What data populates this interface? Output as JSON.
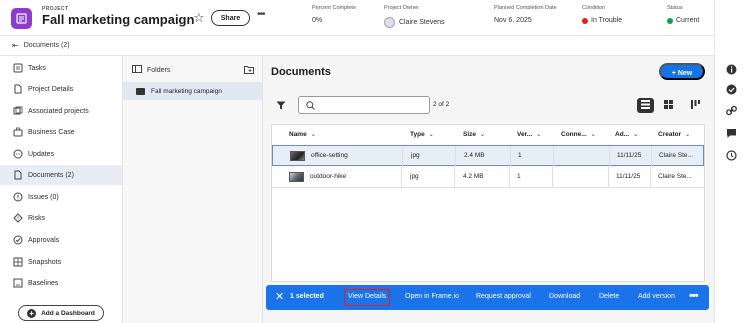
{
  "header": {
    "project_label": "PROJECT",
    "title": "Fall marketing campaign",
    "share_label": "Share",
    "meta": {
      "percent_label": "Percent Complete",
      "percent_value": "0%",
      "owner_label": "Project Owner",
      "owner_value": "Claire Stevens",
      "planned_label": "Planned Completion Date",
      "planned_value": "Nov 6, 2025",
      "condition_label": "Condition",
      "condition_value": "In Trouble",
      "condition_color": "#e02020",
      "status_label": "Status",
      "status_value": "Current",
      "status_color": "#12a14b"
    }
  },
  "breadcrumb": {
    "label": "Documents (2)"
  },
  "sidebar": {
    "items": [
      {
        "label": "Tasks",
        "icon": "tasks-icon"
      },
      {
        "label": "Project Details",
        "icon": "details-icon"
      },
      {
        "label": "Associated projects",
        "icon": "projects-icon"
      },
      {
        "label": "Business Case",
        "icon": "business-case-icon"
      },
      {
        "label": "Updates",
        "icon": "updates-icon"
      },
      {
        "label": "Documents (2)",
        "icon": "documents-icon"
      },
      {
        "label": "Issues (0)",
        "icon": "issues-icon"
      },
      {
        "label": "Risks",
        "icon": "risks-icon"
      },
      {
        "label": "Approvals",
        "icon": "approvals-icon"
      },
      {
        "label": "Snapshots",
        "icon": "snapshots-icon"
      },
      {
        "label": "Baselines",
        "icon": "baselines-icon"
      }
    ],
    "add_dashboard_label": "Add a Dashboard"
  },
  "folders": {
    "header": "Folders",
    "items": [
      {
        "label": "Fall marketing campaign"
      }
    ]
  },
  "documents": {
    "title": "Documents",
    "new_label": "New",
    "search_placeholder": "",
    "page_count": "2 of 2",
    "columns": [
      "Name",
      "Type",
      "Size",
      "Ver...",
      "Conne...",
      "Ad...",
      "Creator"
    ],
    "rows": [
      {
        "name": "office-setting",
        "type": "jpg",
        "size": "2.4 MB",
        "version": "1",
        "connected": "",
        "added": "11/11/25",
        "creator": "Claire Ste..."
      },
      {
        "name": "outdoor-hike",
        "type": "jpg",
        "size": "4.2 MB",
        "version": "1",
        "connected": "",
        "added": "11/11/25",
        "creator": "Claire Ste..."
      }
    ]
  },
  "action_bar": {
    "selected": "1 selected",
    "view_details": "View Details",
    "open_frame": "Open in Frame.io",
    "request_approval": "Request approval",
    "download": "Download",
    "delete": "Delete",
    "add_version": "Add version"
  }
}
